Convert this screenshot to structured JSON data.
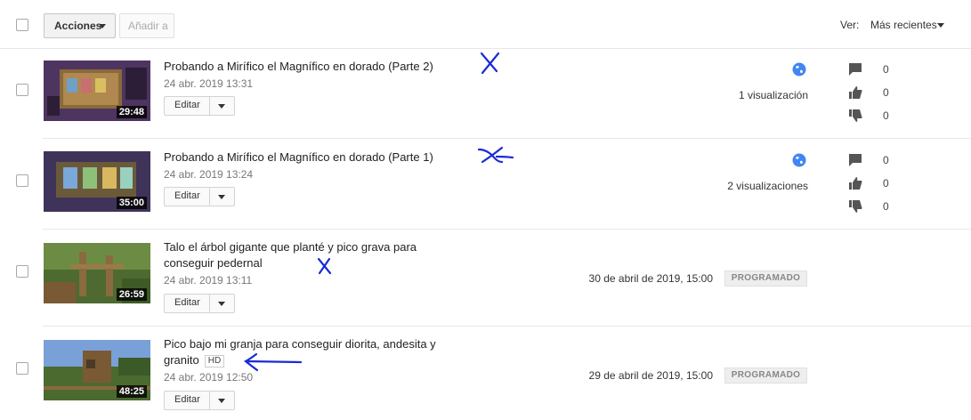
{
  "toolbar": {
    "actions_label": "Acciones",
    "add_to_label": "Añadir a",
    "view_label": "Ver:",
    "view_selected": "Más recientes"
  },
  "videos": [
    {
      "title": "Probando a Mirífico el Magnífico en dorado (Parte 2)",
      "date": "24 abr. 2019 13:31",
      "duration": "29:48",
      "edit_label": "Editar",
      "views": "1 visualización",
      "visibility_icon": "globe-icon",
      "comments": "0",
      "likes": "0",
      "dislikes": "0"
    },
    {
      "title": "Probando a Mirífico el Magnífico en dorado (Parte 1)",
      "date": "24 abr. 2019 13:24",
      "duration": "35:00",
      "edit_label": "Editar",
      "views": "2 visualizaciones",
      "visibility_icon": "globe-icon",
      "comments": "0",
      "likes": "0",
      "dislikes": "0"
    },
    {
      "title": "Talo el árbol gigante que planté y pico grava para conseguir pedernal",
      "date": "24 abr. 2019 13:11",
      "duration": "26:59",
      "edit_label": "Editar",
      "scheduled_date": "30 de abril de 2019, 15:00",
      "status_badge": "PROGRAMADO"
    },
    {
      "title": "Pico bajo mi granja para conseguir diorita, andesita y granito",
      "hd_badge": "HD",
      "date": "24 abr. 2019 12:50",
      "duration": "48:25",
      "edit_label": "Editar",
      "scheduled_date": "29 de abril de 2019, 15:00",
      "status_badge": "PROGRAMADO"
    }
  ],
  "colors": {
    "accent_blue": "#4285f4",
    "annotation_ink": "#1a2bd6",
    "badge_bg": "#eeeeee"
  }
}
